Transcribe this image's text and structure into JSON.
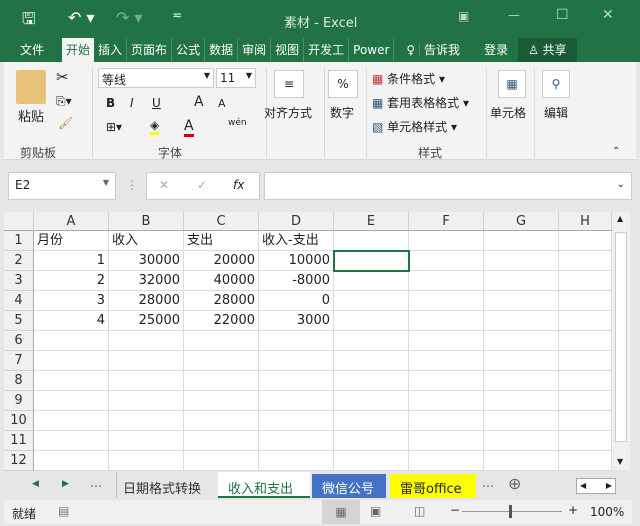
{
  "title": "素材 - Excel",
  "tabs": [
    "文件",
    "开始",
    "插入",
    "页面布",
    "公式",
    "数据",
    "审阅",
    "视图",
    "开发工",
    "Power"
  ],
  "tell_me": "告诉我",
  "login": "登录",
  "share": "共享",
  "ribbon": {
    "paste": "粘贴",
    "clipboard": "剪贴板",
    "font_name": "等线",
    "font_size": "11",
    "bold": "B",
    "italic": "I",
    "underline": "U",
    "grow": "A",
    "shrink": "A",
    "font_color": "A",
    "phonetic": "wén",
    "font_group": "字体",
    "align": "对齐方式",
    "number": "数字",
    "percent": "%",
    "cond_format": "条件格式",
    "table_format": "套用表格格式",
    "cell_style": "单元格样式",
    "styles_group": "样式",
    "cells": "单元格",
    "edit": "编辑"
  },
  "formula_bar": {
    "name_box": "E2",
    "fx": "fx",
    "value": ""
  },
  "columns": [
    "A",
    "B",
    "C",
    "D",
    "E",
    "F",
    "G",
    "H"
  ],
  "rows": [
    "1",
    "2",
    "3",
    "4",
    "5",
    "6",
    "7",
    "8",
    "9",
    "10",
    "11",
    "12"
  ],
  "cells": [
    [
      "月份",
      "收入",
      "支出",
      "收入-支出"
    ],
    [
      "1",
      "30000",
      "20000",
      "10000"
    ],
    [
      "2",
      "32000",
      "40000",
      "-8000"
    ],
    [
      "3",
      "28000",
      "28000",
      "0"
    ],
    [
      "4",
      "25000",
      "22000",
      "3000"
    ]
  ],
  "sheets": [
    "日期格式转换",
    "收入和支出",
    "微信公号",
    "雷哥office"
  ],
  "active_sheet": "收入和支出",
  "status": {
    "ready": "就绪",
    "zoom": "100%"
  },
  "colors": {
    "excel_green": "#217346",
    "sheet_blue": "#4472c4",
    "sheet_yellow": "#ffff00"
  }
}
